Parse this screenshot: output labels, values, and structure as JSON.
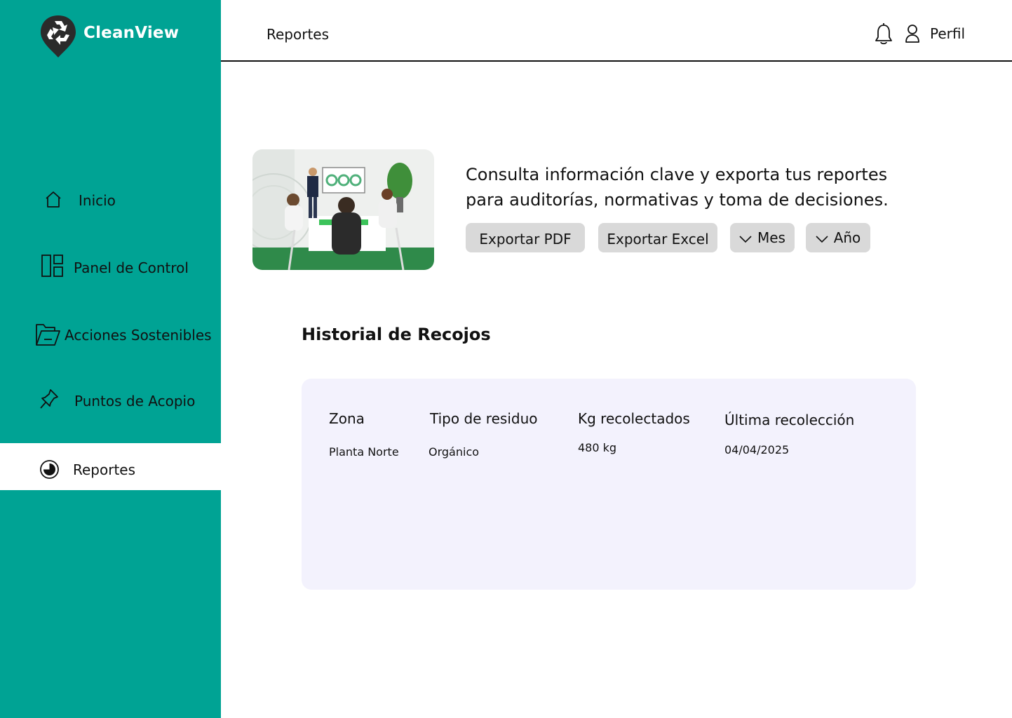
{
  "app": {
    "name": "CleanView"
  },
  "sidebar": {
    "items": [
      {
        "label": "Inicio",
        "icon": "home-icon"
      },
      {
        "label": "Panel de Control",
        "icon": "dashboard-icon"
      },
      {
        "label": "Acciones Sostenibles",
        "icon": "folder-icon"
      },
      {
        "label": "Puntos de Acopio",
        "icon": "pin-icon"
      },
      {
        "label": "Reportes",
        "icon": "pie-chart-icon",
        "active": true
      }
    ]
  },
  "header": {
    "title": "Reportes",
    "profile_label": "Perfil"
  },
  "intro": {
    "text": "Consulta información clave y exporta tus reportes para auditorías, normativas y toma de decisiones."
  },
  "actions": {
    "export_pdf": "Exportar PDF",
    "export_excel": "Exportar Excel",
    "month_filter": "Mes",
    "year_filter": "Año"
  },
  "history": {
    "title": "Historial de Recojos",
    "columns": [
      "Zona",
      "Tipo de residuo",
      "Kg recolectados",
      "Última recolección"
    ],
    "rows": [
      [
        "Planta Norte",
        "Orgánico",
        "480 kg",
        "04/04/2025"
      ]
    ]
  },
  "colors": {
    "sidebar": "#00a394",
    "table_background": "#f3f2fd",
    "button": "#d9d9d9"
  }
}
